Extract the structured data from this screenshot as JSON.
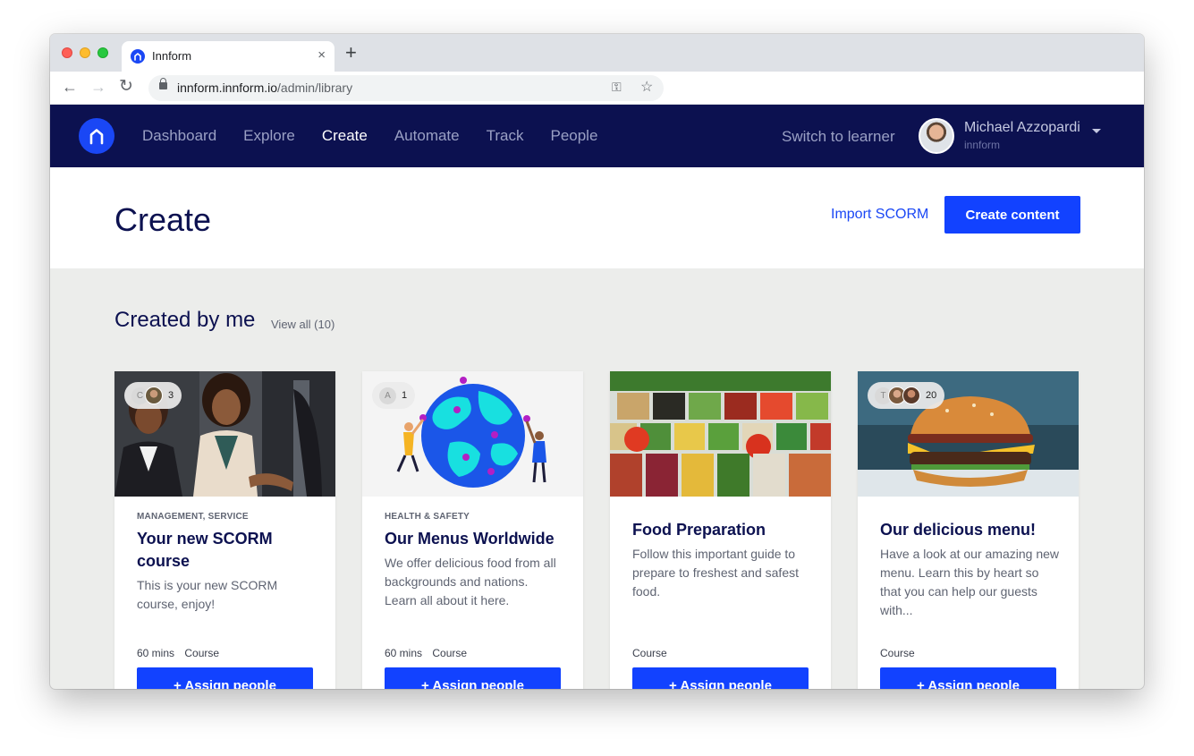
{
  "browser": {
    "tab_title": "Innform",
    "new_tab": "+",
    "close_tab": "×",
    "url_host": "innform.innform.io",
    "url_path": "/admin/library",
    "back_glyph": "←",
    "forward_glyph": "→",
    "reload_glyph": "↻",
    "key_glyph": "⚿",
    "star_glyph": "☆"
  },
  "nav": {
    "items": [
      "Dashboard",
      "Explore",
      "Create",
      "Automate",
      "Track",
      "People"
    ],
    "active": "Create",
    "switch_label": "Switch to learner",
    "user_name": "Michael Azzopardi",
    "user_org": "innform"
  },
  "header": {
    "title": "Create",
    "import_label": "Import SCORM",
    "create_label": "Create content"
  },
  "section": {
    "title": "Created by me",
    "view_all": "View all (10)"
  },
  "cards": [
    {
      "category": "MANAGEMENT, SERVICE",
      "title": "Your new SCORM course",
      "description": "This is your new SCORM course, enjoy!",
      "duration": "60 mins",
      "type": "Course",
      "badge_initial": "C",
      "badge_count": "3",
      "button": "+ Assign people"
    },
    {
      "category": "HEALTH & SAFETY",
      "title": "Our Menus Worldwide",
      "description": "We offer delicious food from all backgrounds and nations. Learn all about it here.",
      "duration": "60 mins",
      "type": "Course",
      "badge_initial": "A",
      "badge_count": "1",
      "button": "+ Assign people"
    },
    {
      "category": "",
      "title": "Food Preparation",
      "description": "Follow this important guide to prepare to freshest and safest food.",
      "duration": "",
      "type": "Course",
      "badge_initial": "",
      "badge_count": "",
      "button": "+ Assign people"
    },
    {
      "category": "",
      "title": "Our delicious menu!",
      "description": "Have a look at our amazing new menu. Learn this by heart so that you can help our guests with...",
      "duration": "",
      "type": "Course",
      "badge_initial": "T",
      "badge_count": "20",
      "button": "+ Assign people"
    }
  ],
  "colors": {
    "nav_bg": "#0c1150",
    "accent": "#1242ff",
    "page_bg": "#ecedeb"
  }
}
